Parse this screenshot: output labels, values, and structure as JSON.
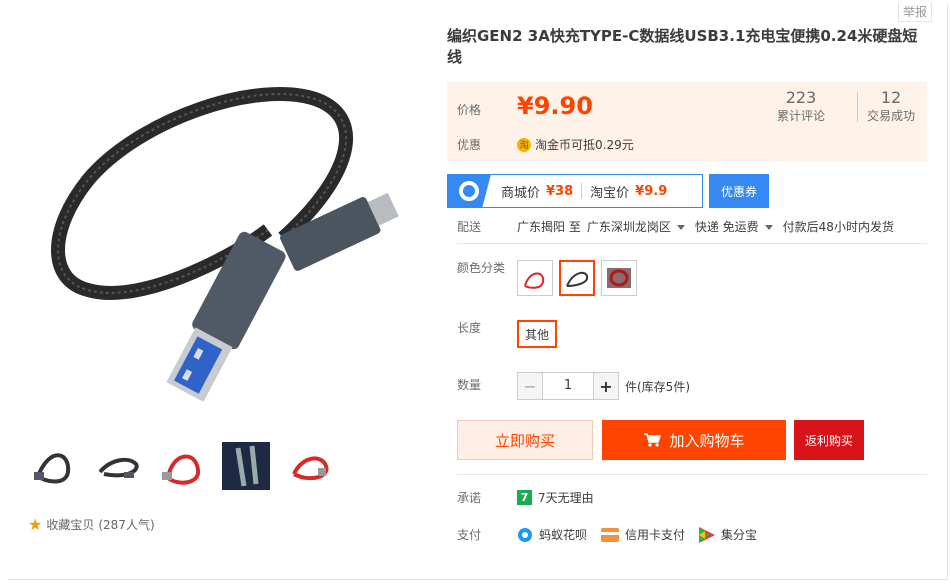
{
  "report": "举报",
  "title": "编织GEN2 3A快充TYPE-C数据线USB3.1充电宝便携0.24米硬盘短线",
  "price": {
    "label": "价格",
    "value": "¥9.90"
  },
  "stats": [
    {
      "num": "223",
      "label": "累计评论"
    },
    {
      "num": "12",
      "label": "交易成功"
    }
  ],
  "promo": {
    "label": "优惠",
    "text": "淘金币可抵",
    "amount": "0.29元",
    "coin_icon": "淘"
  },
  "compare": {
    "mall_label": "商城价",
    "mall_price": "¥38",
    "tb_label": "淘宝价",
    "tb_price": "¥9.9",
    "coupon": "优惠券"
  },
  "delivery": {
    "label": "配送",
    "from": "广东揭阳 至",
    "to": "广东深圳龙岗区",
    "method": "快递 免运费",
    "ship": "付款后48小时内发货"
  },
  "sku": {
    "color_label": "颜色分类",
    "length_label": "长度",
    "length_value": "其他",
    "qty_label": "数量",
    "qty_value": "1",
    "stock": "件(库存5件)"
  },
  "actions": {
    "buy": "立即购买",
    "cart": "加入购物车",
    "rebate": "返利购买"
  },
  "promise": {
    "label": "承诺",
    "icon": "7",
    "text": "7天无理由"
  },
  "pay": {
    "label": "支付",
    "items": [
      "蚂蚁花呗",
      "信用卡支付",
      "集分宝"
    ]
  },
  "favorite": {
    "text": "收藏宝贝",
    "count": "(287人气)"
  },
  "colors": {
    "accent": "#ff4400",
    "blue": "#3689f0",
    "rebate": "#d8141b"
  }
}
